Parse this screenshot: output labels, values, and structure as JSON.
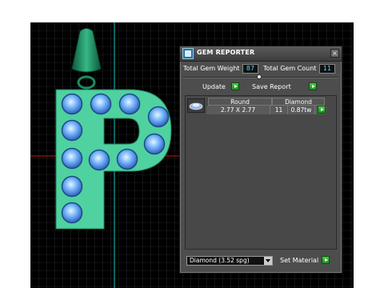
{
  "window": {
    "title": "GEM REPORTER",
    "close_glyph": "×"
  },
  "totals": {
    "weight_label": "Total Gem Weight",
    "weight_value": "87",
    "count_label": "Total Gem Count",
    "count_value": "11"
  },
  "actions": {
    "update_label": "Update",
    "save_label": "Save Report"
  },
  "table": {
    "headers": [
      "Round",
      "Diamond"
    ],
    "rows": [
      {
        "size": "2.77 X 2.77",
        "count": "11",
        "weight": "0.87tw"
      }
    ]
  },
  "material": {
    "selected": "Diamond",
    "spg": "(3.52 spg)",
    "set_label": "Set Material"
  },
  "colors": {
    "pendant": "#4fd1a0",
    "gem": "#5aa0ff",
    "value_text": "#52d8ff",
    "button_green": "#2fa82f"
  },
  "icons": [
    "app-icon",
    "close-icon",
    "play-icon",
    "dropdown-arrow-icon",
    "gem-thumbnail-icon"
  ]
}
